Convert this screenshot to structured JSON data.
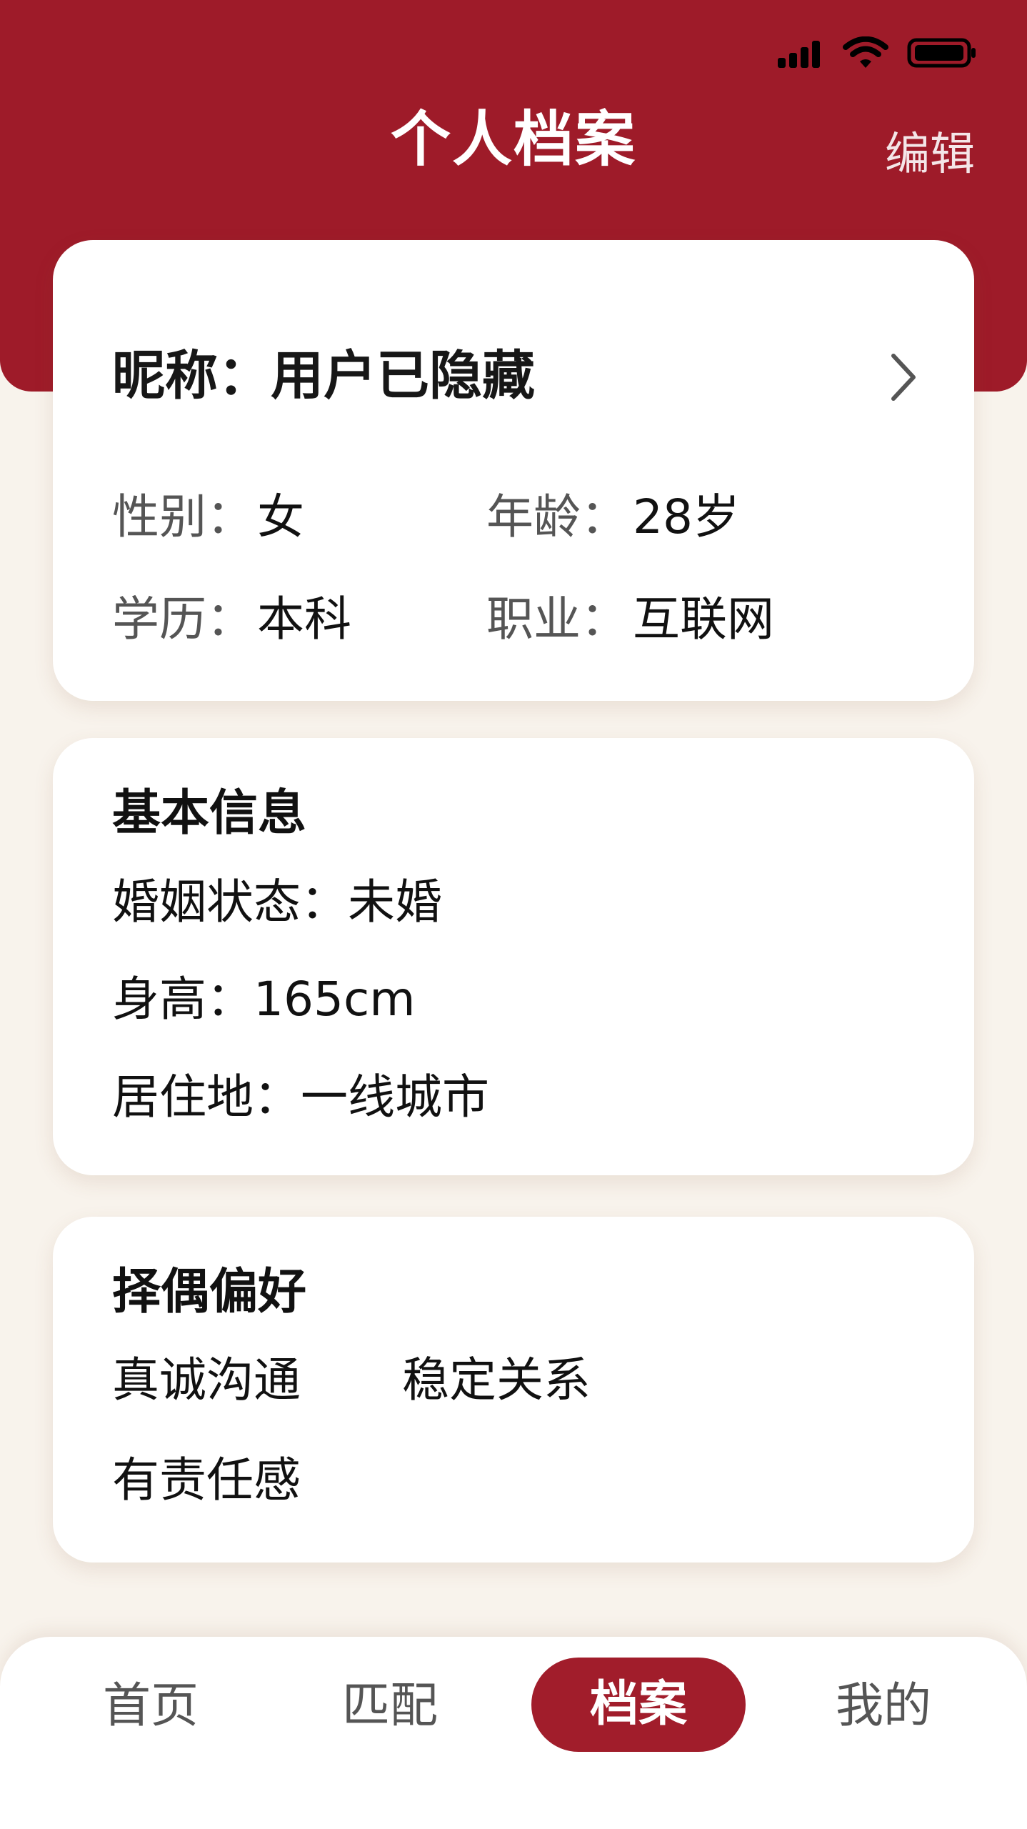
{
  "app": {
    "title": "个人档案",
    "edit_label": "编辑",
    "accent_color": "#9e1b29",
    "background_color": "#f8f3ec"
  },
  "status_bar": {
    "icons": [
      "signal-icon",
      "wifi-icon",
      "battery-icon"
    ]
  },
  "profile": {
    "nickname": "昵称：用户已隐藏",
    "gender_label": "性别：",
    "gender_value": "女",
    "age_label": "年龄：",
    "age_value": "28岁",
    "education_label": "学历：",
    "education_value": "本科",
    "occupation_label": "职业：",
    "occupation_value": "互联网",
    "chevron_icon": "chevron-right-icon"
  },
  "basic_info": {
    "title": "基本信息",
    "items": [
      "婚姻状态：未婚",
      "身高：165cm",
      "居住地：一线城市"
    ]
  },
  "preferences": {
    "title": "择偶偏好",
    "tags": [
      "真诚沟通",
      "稳定关系",
      "有责任感"
    ]
  },
  "bottom_nav": {
    "items": [
      {
        "label": "首页",
        "active": false
      },
      {
        "label": "匹配",
        "active": false
      },
      {
        "label": "档案",
        "active": true
      },
      {
        "label": "我的",
        "active": false
      }
    ]
  }
}
